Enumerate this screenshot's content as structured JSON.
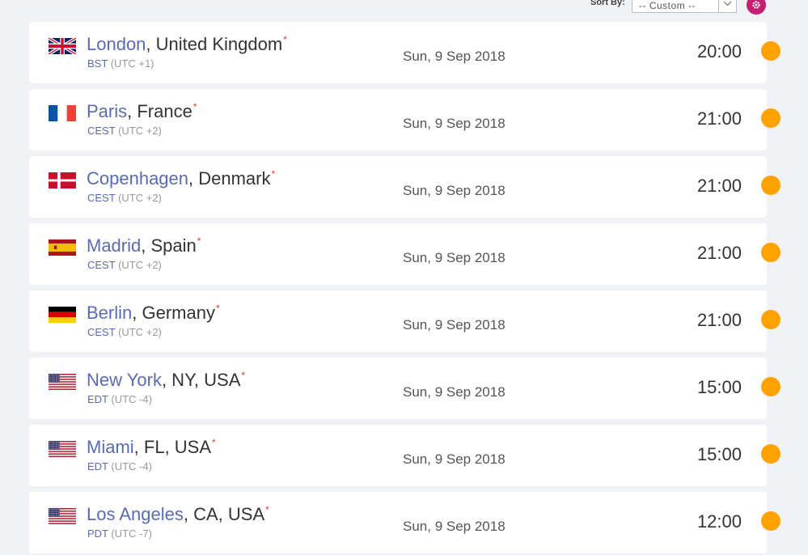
{
  "sort": {
    "label": "Sort By:",
    "value": "-- Custom --"
  },
  "colors": {
    "accent": "#c51d72",
    "city_link": "#5a6bb5",
    "day_dot": "#ffa200",
    "asterisk": "#e53935"
  },
  "rows": [
    {
      "flag": "uk-flag-icon",
      "city": "London",
      "country": ", United Kingdom",
      "star": "*",
      "tz": "BST",
      "offset": "(UTC +1)",
      "date": "Sun, 9 Sep 2018",
      "time": "20:00",
      "daylight": "sun-icon"
    },
    {
      "flag": "france-flag-icon",
      "city": "Paris",
      "country": ", France",
      "star": "*",
      "tz": "CEST",
      "offset": "(UTC +2)",
      "date": "Sun, 9 Sep 2018",
      "time": "21:00",
      "daylight": "sun-icon"
    },
    {
      "flag": "denmark-flag-icon",
      "city": "Copenhagen",
      "country": ", Denmark",
      "star": "*",
      "tz": "CEST",
      "offset": "(UTC +2)",
      "date": "Sun, 9 Sep 2018",
      "time": "21:00",
      "daylight": "sun-icon"
    },
    {
      "flag": "spain-flag-icon",
      "city": "Madrid",
      "country": ", Spain",
      "star": "*",
      "tz": "CEST",
      "offset": "(UTC +2)",
      "date": "Sun, 9 Sep 2018",
      "time": "21:00",
      "daylight": "sun-icon"
    },
    {
      "flag": "germany-flag-icon",
      "city": "Berlin",
      "country": ", Germany",
      "star": "*",
      "tz": "CEST",
      "offset": "(UTC +2)",
      "date": "Sun, 9 Sep 2018",
      "time": "21:00",
      "daylight": "sun-icon"
    },
    {
      "flag": "usa-flag-icon",
      "city": "New York",
      "country": ", NY, USA",
      "star": "*",
      "tz": "EDT",
      "offset": "(UTC -4)",
      "date": "Sun, 9 Sep 2018",
      "time": "15:00",
      "daylight": "sun-icon"
    },
    {
      "flag": "usa-flag-icon",
      "city": "Miami",
      "country": ", FL, USA",
      "star": "*",
      "tz": "EDT",
      "offset": "(UTC -4)",
      "date": "Sun, 9 Sep 2018",
      "time": "15:00",
      "daylight": "sun-icon"
    },
    {
      "flag": "usa-flag-icon",
      "city": "Los Angeles",
      "country": ", CA, USA",
      "star": "*",
      "tz": "PDT",
      "offset": "(UTC -7)",
      "date": "Sun, 9 Sep 2018",
      "time": "12:00",
      "daylight": "sun-icon"
    }
  ]
}
